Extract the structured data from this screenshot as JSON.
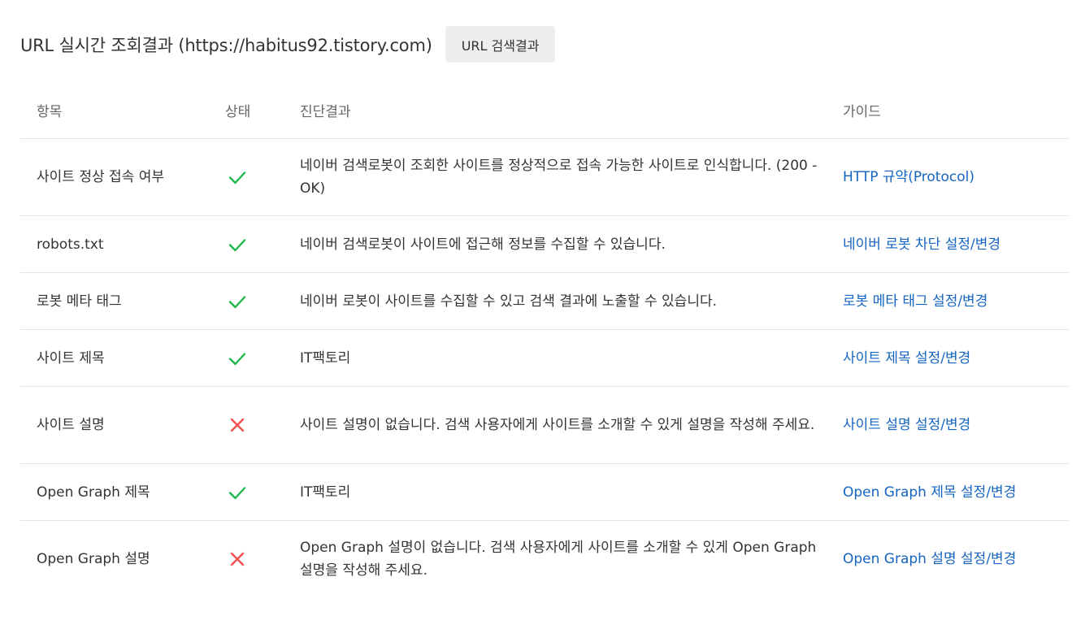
{
  "header": {
    "title": "URL 실시간 조회결과 (https://habitus92.tistory.com)",
    "search_button_label": "URL 검색결과"
  },
  "table": {
    "columns": [
      "항목",
      "상태",
      "진단결과",
      "가이드"
    ],
    "rows": [
      {
        "item": "사이트 정상 접속 여부",
        "status": "pass",
        "result": "네이버 검색로봇이 조회한 사이트를 정상적으로 접속 가능한 사이트로 인식합니다. (200 - OK)",
        "guide": "HTTP 규약(Protocol)"
      },
      {
        "item": "robots.txt",
        "status": "pass",
        "result": "네이버 검색로봇이 사이트에 접근해 정보를 수집할 수 있습니다.",
        "guide": "네이버 로봇 차단 설정/변경"
      },
      {
        "item": "로봇 메타 태그",
        "status": "pass",
        "result": "네이버 로봇이 사이트를 수집할 수 있고 검색 결과에 노출할 수 있습니다.",
        "guide": "로봇 메타 태그 설정/변경"
      },
      {
        "item": "사이트 제목",
        "status": "pass",
        "result": "IT팩토리",
        "guide": "사이트 제목 설정/변경"
      },
      {
        "item": "사이트 설명",
        "status": "fail",
        "result": "사이트 설명이 없습니다. 검색 사용자에게 사이트를 소개할 수 있게 설명을 작성해 주세요.",
        "guide": "사이트 설명 설정/변경"
      },
      {
        "item": "Open Graph 제목",
        "status": "pass",
        "result": "IT팩토리",
        "guide": "Open Graph 제목 설정/변경"
      },
      {
        "item": "Open Graph 설명",
        "status": "fail",
        "result": "Open Graph 설명이 없습니다. 검색 사용자에게 사이트를 소개할 수 있게 Open Graph 설명을 작성해 주세요.",
        "guide": "Open Graph 설명 설정/변경"
      }
    ]
  },
  "icons": {
    "pass": "check-icon",
    "fail": "close-icon"
  },
  "colors": {
    "pass": "#1fb84f",
    "fail": "#f05050",
    "link": "#1565c0",
    "button_bg": "#eceef0"
  }
}
